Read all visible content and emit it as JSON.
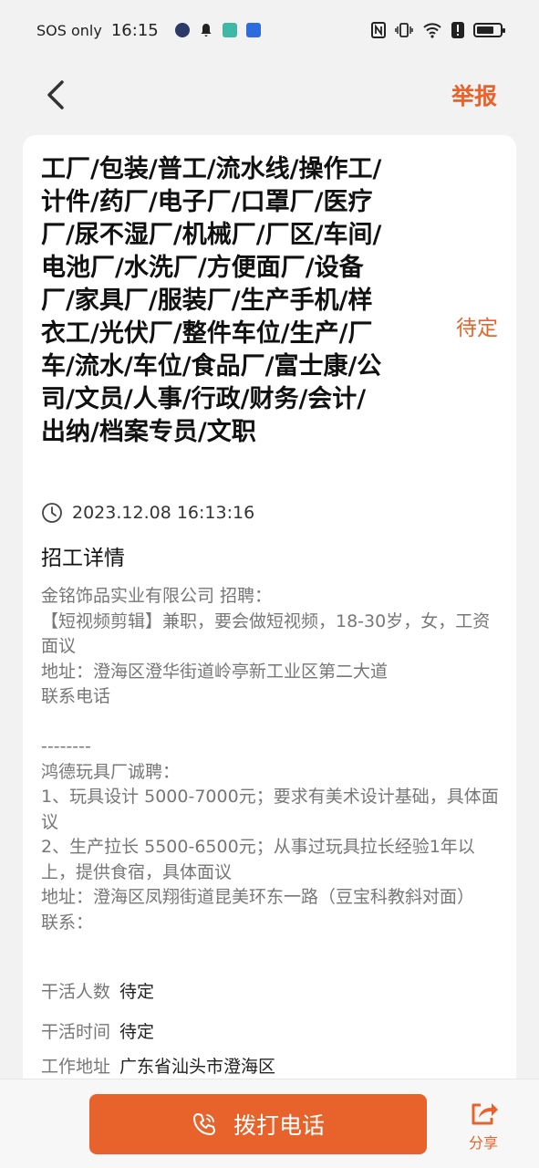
{
  "status_bar": {
    "carrier": "SOS only",
    "time": "16:15"
  },
  "nav": {
    "report_label": "举报"
  },
  "job": {
    "title": "工厂/包装/普工/流水线/操作工/计件/药厂/电子厂/口罩厂/医疗厂/尿不湿厂/机械厂/厂区/车间/电池厂/水洗厂/方便面厂/设备厂/家具厂/服装厂/生产手机/样衣工/光伏厂/整件车位/生产/厂车/流水/车位/食品厂/富士康/公司/文员/人事/行政/财务/会计/出纳/档案专员/文职",
    "salary": "待定",
    "posted_at": "2023.12.08 16:13:16",
    "details_heading": "招工详情",
    "description": "金铭饰品实业有限公司 招聘：\n【短视频剪辑】兼职，要会做短视频，18-30岁，女，工资面议\n地址：澄海区澄华街道岭亭新工业区第二大道\n联系电话\n\n--------\n鸿德玩具厂诚聘：\n1、玩具设计 5000-7000元；要求有美术设计基础，具体面议\n2、生产拉长 5500-6500元；从事过玩具拉长经验1年以上，提供食宿，具体面议\n地址：澄海区凤翔街道昆美环东一路（豆宝科教斜对面）\n联系：",
    "info": [
      {
        "label": "干活人数",
        "value": "待定"
      },
      {
        "label": "干活时间",
        "value": "待定"
      },
      {
        "label": "工作地址",
        "value": "广东省汕头市澄海区"
      }
    ]
  },
  "bottom": {
    "call_label": "拨打电话",
    "share_label": "分享"
  },
  "colors": {
    "accent": "#e8632b",
    "background": "#f2f2f2"
  }
}
